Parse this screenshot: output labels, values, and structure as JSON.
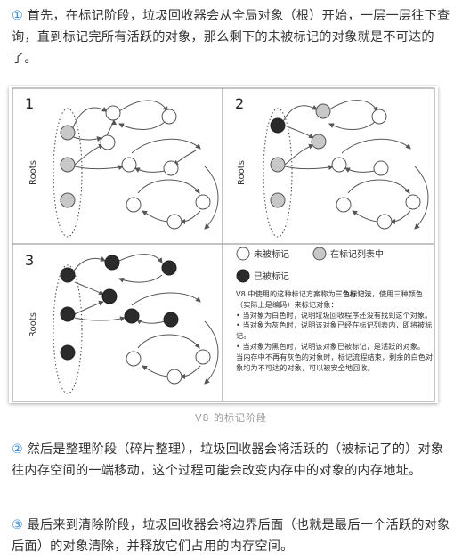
{
  "paragraphs": {
    "p1_marker": "①",
    "p1_text": " 首先，在标记阶段，垃圾回收器会从全局对象（根）开始，一层一层往下查询，直到标记完所有活跃的对象，那么剩下的未被标记的对象就是不可达的了。",
    "p2_marker": "②",
    "p2_text": " 然后是整理阶段（碎片整理），垃圾回收器会将活跃的（被标记了的）对象往内存空间的一端移动，这个过程可能会改变内存中的对象的内存地址。",
    "p3_marker": "③",
    "p3_text": " 最后来到清除阶段，垃圾回收器会将边界后面（也就是最后一个活跃的对象后面）的对象清除，并释放它们占用的内存空间。"
  },
  "figure": {
    "caption": "V8 的标记阶段",
    "panels": [
      {
        "number": "1",
        "roots_label": "Roots"
      },
      {
        "number": "2",
        "roots_label": "Roots"
      },
      {
        "number": "3",
        "roots_label": "Roots"
      }
    ],
    "legend": {
      "white_label": "未被标记",
      "gray_label": "在标记列表中",
      "black_label": "已被标记"
    },
    "note": {
      "intro": "V8 中使用的这种标记方案称为",
      "term": "三色标记法",
      "intro_tail": "，使用三种颜色（实际上是编码）来标记对象：",
      "item1": "• 当对象为白色时，说明垃圾回收程序还没有找到这个对象。",
      "item2": "• 当对象为灰色时，说明该对象已经在标记列表内，即将被标记。",
      "item3": "• 当对象为黑色时，说明该对象已被标记，是活跃的对象。",
      "outro": "当内存中不再有灰色的对象时，标记流程结束，剩余的白色对象均为不可达的对象，可以被安全地回收。"
    },
    "colors": {
      "white_node": "#ffffff",
      "gray_node": "#c8c8c8",
      "black_node": "#2b2b2b"
    }
  }
}
